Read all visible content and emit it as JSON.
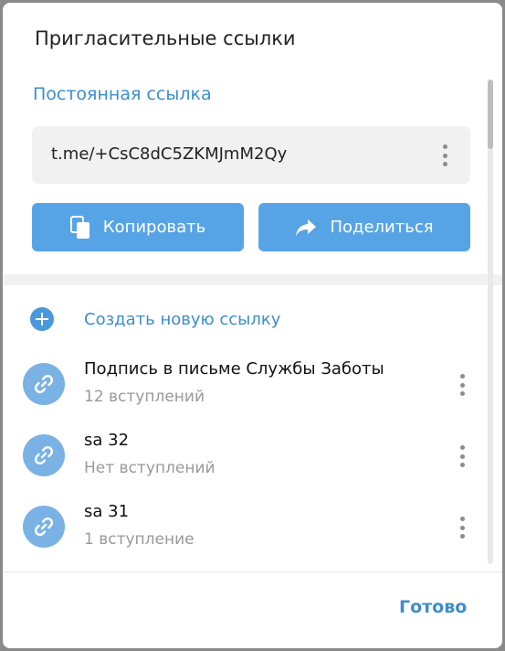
{
  "dialog": {
    "title": "Пригласительные ссылки",
    "permanent_link_title": "Постоянная ссылка",
    "permanent_link": "t.me/+CsC8dC5ZKMJmM2Qy",
    "copy_label": "Копировать",
    "share_label": "Поделиться",
    "create_label": "Создать новую ссылку",
    "links": [
      {
        "title": "Подпись в письме Службы Заботы",
        "subtitle": "12 вступлений"
      },
      {
        "title": "sa 32",
        "subtitle": "Нет вступлений"
      },
      {
        "title": "sa 31",
        "subtitle": "1 вступление"
      }
    ],
    "done_label": "Готово"
  },
  "colors": {
    "accent": "#3d8ecc",
    "button": "#56a4e6",
    "avatar": "#7ab2e6"
  },
  "icons": [
    "copy-icon",
    "share-icon",
    "plus-icon",
    "link-icon",
    "more-vertical-icon"
  ]
}
